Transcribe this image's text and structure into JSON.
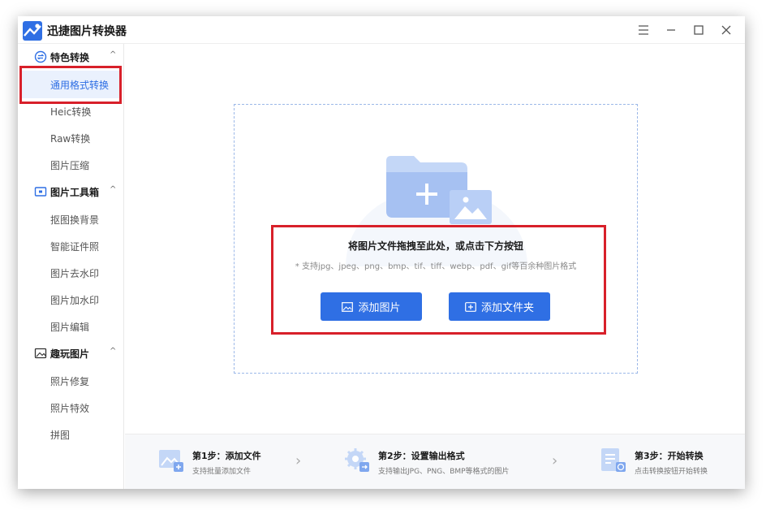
{
  "app": {
    "title": "迅捷图片转换器"
  },
  "window_controls": [
    "menu-icon",
    "minimize-icon",
    "maximize-icon",
    "close-icon"
  ],
  "sidebar": {
    "groups": [
      {
        "label": "特色转换",
        "icon": "swap-icon",
        "chevron": "^",
        "items": [
          {
            "label": "通用格式转换",
            "active": true
          },
          {
            "label": "Heic转换"
          },
          {
            "label": "Raw转换"
          },
          {
            "label": "图片压缩"
          }
        ]
      },
      {
        "label": "图片工具箱",
        "icon": "toolbox-icon",
        "chevron": "^",
        "items": [
          {
            "label": "抠图换背景"
          },
          {
            "label": "智能证件照"
          },
          {
            "label": "图片去水印"
          },
          {
            "label": "图片加水印"
          },
          {
            "label": "图片编辑"
          }
        ]
      },
      {
        "label": "趣玩图片",
        "icon": "image-icon",
        "chevron": "^",
        "items": [
          {
            "label": "照片修复"
          },
          {
            "label": "照片特效"
          },
          {
            "label": "拼图"
          }
        ]
      }
    ]
  },
  "dropzone": {
    "title": "将图片文件拖拽至此处，或点击下方按钮",
    "hint": "* 支持jpg、jpeg、png、bmp、tif、tiff、webp、pdf、gif等百余种图片格式",
    "add_image_label": "添加图片",
    "add_folder_label": "添加文件夹"
  },
  "steps": [
    {
      "title": "第1步：添加文件",
      "subtitle": "支持批量添加文件"
    },
    {
      "title": "第2步：设置输出格式",
      "subtitle": "支持输出JPG、PNG、BMP等格式的图片"
    },
    {
      "title": "第3步：开始转换",
      "subtitle": "点击转换按钮开始转换"
    }
  ],
  "colors": {
    "accent": "#2f6fe4",
    "highlight": "#d8202a"
  }
}
